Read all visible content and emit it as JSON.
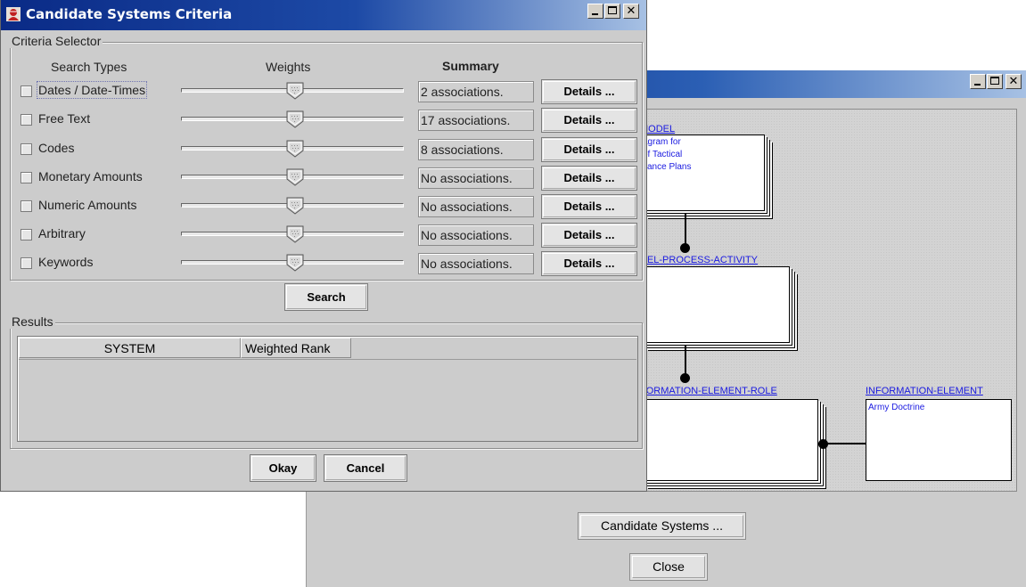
{
  "back_window": {
    "entities": [
      {
        "label": "MODEL",
        "text": [
          "agram for",
          "of Tactical",
          "sance Plans"
        ]
      },
      {
        "label": "DEL-PROCESS-ACTIVITY",
        "text": []
      },
      {
        "label": "FORMATION-ELEMENT-ROLE",
        "text": []
      },
      {
        "label": "INFORMATION-ELEMENT",
        "text": [
          "Army Doctrine"
        ]
      }
    ],
    "candidate_button": "Candidate Systems ...",
    "close_button": "Close"
  },
  "dialog": {
    "title": "Candidate Systems Criteria",
    "criteria_group": "Criteria Selector",
    "headers": {
      "search_types": "Search Types",
      "weights": "Weights",
      "summary": "Summary"
    },
    "rows": [
      {
        "label": "Dates / Date-Times",
        "summary": "2 associations.",
        "details": "Details ...",
        "checked": false,
        "weight": 0.5,
        "focused": true
      },
      {
        "label": "Free Text",
        "summary": "17 associations.",
        "details": "Details ...",
        "checked": false,
        "weight": 0.5
      },
      {
        "label": "Codes",
        "summary": "8 associations.",
        "details": "Details ...",
        "checked": false,
        "weight": 0.5
      },
      {
        "label": "Monetary Amounts",
        "summary": "No associations.",
        "details": "Details ...",
        "checked": false,
        "weight": 0.5
      },
      {
        "label": "Numeric Amounts",
        "summary": "No associations.",
        "details": "Details ...",
        "checked": false,
        "weight": 0.5
      },
      {
        "label": "Arbitrary",
        "summary": "No associations.",
        "details": "Details ...",
        "checked": false,
        "weight": 0.5
      },
      {
        "label": "Keywords",
        "summary": "No associations.",
        "details": "Details ...",
        "checked": false,
        "weight": 0.5
      }
    ],
    "search_button": "Search",
    "results_group": "Results",
    "results_columns": [
      "SYSTEM",
      "Weighted Rank"
    ],
    "okay_button": "Okay",
    "cancel_button": "Cancel"
  },
  "colors": {
    "titlebar_dark": "#0a2a86",
    "titlebar_light": "#a7c1e4",
    "link_blue": "#1a1ae0",
    "panel": "#cccccc"
  }
}
